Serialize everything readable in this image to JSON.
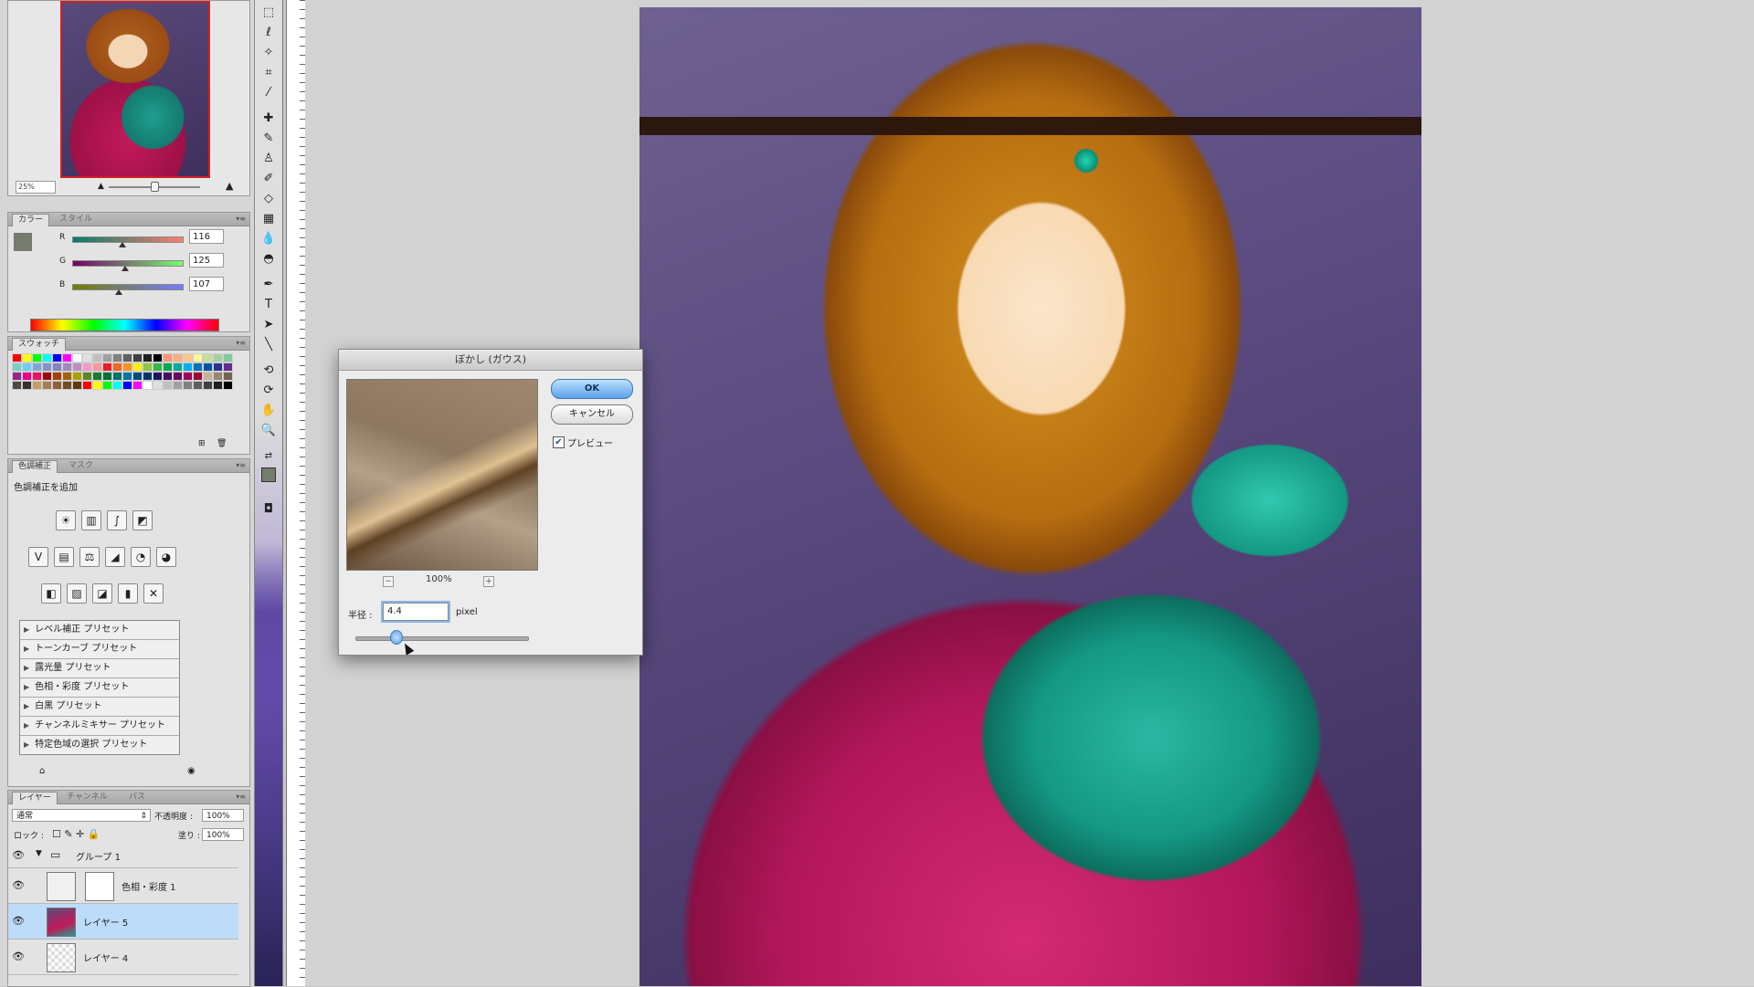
{
  "navigator": {
    "zoom": "25%"
  },
  "color_panel": {
    "tabs": [
      "カラー",
      "スタイル"
    ],
    "channels": [
      {
        "label": "R",
        "value": "116"
      },
      {
        "label": "G",
        "value": "125"
      },
      {
        "label": "B",
        "value": "107"
      }
    ],
    "foreground_color": "#747d6b"
  },
  "swatches_panel": {
    "tab": "スウォッチ"
  },
  "adjustments_panel": {
    "tabs": [
      "色調補正",
      "マスク"
    ],
    "title": "色調補正を追加",
    "presets": [
      "レベル補正 プリセット",
      "トーンカーブ プリセット",
      "露光量 プリセット",
      "色相・彩度 プリセット",
      "白黒 プリセット",
      "チャンネルミキサー プリセット",
      "特定色域の選択 プリセット"
    ]
  },
  "layers_panel": {
    "tabs": [
      "レイヤー",
      "チャンネル",
      "パス"
    ],
    "blend_mode": "通常",
    "opacity_label": "不透明度 :",
    "opacity": "100%",
    "lock_label": "ロック :",
    "fill_label": "塗り :",
    "fill": "100%",
    "layers": [
      {
        "name": "グループ 1",
        "type": "group"
      },
      {
        "name": "色相・彩度 1",
        "type": "adjustment"
      },
      {
        "name": "レイヤー 5",
        "type": "pixel",
        "selected": true
      },
      {
        "name": "レイヤー 4",
        "type": "pixel"
      }
    ]
  },
  "dialog": {
    "title": "ぼかし (ガウス)",
    "ok_label": "OK",
    "cancel_label": "キャンセル",
    "preview_label": "プレビュー",
    "preview_checked": true,
    "zoom": "100%",
    "radius_label": "半径 :",
    "radius_value": "4.4",
    "radius_unit": "pixel"
  },
  "colors": {
    "accent": "#5aa2e8",
    "selection": "#bcdcfa"
  }
}
